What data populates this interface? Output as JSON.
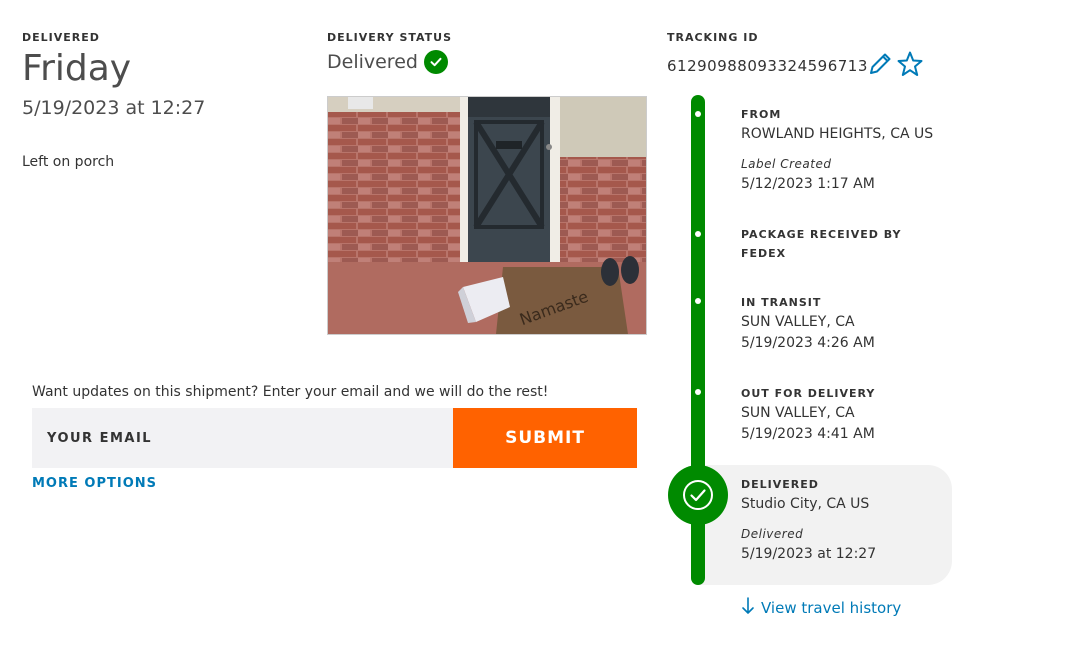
{
  "delivered": {
    "label": "DELIVERED",
    "day": "Friday",
    "datetime": "5/19/2023 at 12:27",
    "note": "Left on porch"
  },
  "delivery_status": {
    "label": "DELIVERY STATUS",
    "value": "Delivered",
    "icon": "check-circle-icon"
  },
  "tracking": {
    "label": "TRACKING ID",
    "id": "612909880933245967​13",
    "edit_icon": "pencil-icon",
    "favorite_icon": "star-outline-icon"
  },
  "email_signup": {
    "prompt": "Want updates on this shipment? Enter your email and we will do the rest!",
    "placeholder": "YOUR EMAIL",
    "submit_label": "SUBMIT",
    "more_options": "MORE OPTIONS"
  },
  "timeline": [
    {
      "title": "FROM",
      "lines": [
        "ROWLAND HEIGHTS, CA US"
      ],
      "italic": "Label Created",
      "time": "5/12/2023 1:17 AM"
    },
    {
      "title": "PACKAGE RECEIVED BY FEDEX",
      "lines": [],
      "italic": "",
      "time": ""
    },
    {
      "title": "IN TRANSIT",
      "lines": [
        "SUN VALLEY, CA"
      ],
      "italic": "",
      "time": "5/19/2023 4:26 AM"
    },
    {
      "title": "OUT FOR DELIVERY",
      "lines": [
        "SUN VALLEY, CA"
      ],
      "italic": "",
      "time": "5/19/2023 4:41 AM"
    },
    {
      "title": "DELIVERED",
      "lines": [
        "Studio City, CA US"
      ],
      "italic": "Delivered",
      "time": "5/19/2023 at 12:27"
    }
  ],
  "view_history": "View travel history",
  "colors": {
    "accent_green": "#008a00",
    "submit_orange": "#ff6200",
    "link_blue": "#007ab7"
  }
}
